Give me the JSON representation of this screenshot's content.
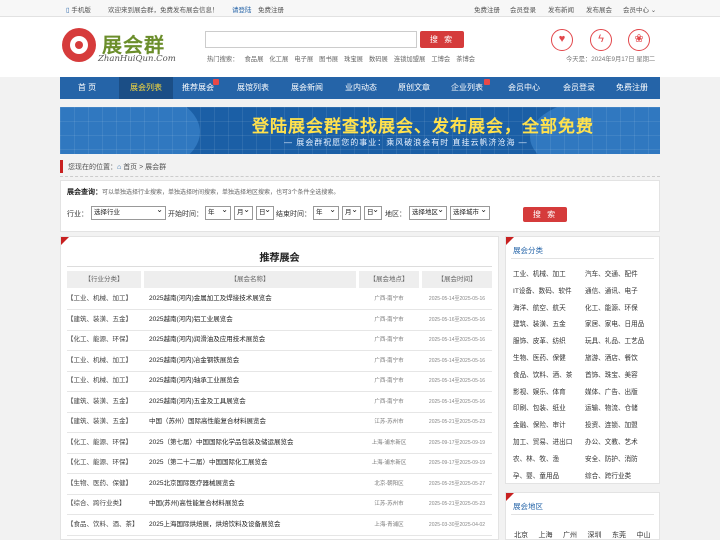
{
  "topbar": {
    "mobile": "手机版",
    "welcome": "欢迎来到展会群，免费发布展会信息！",
    "login": "请登陆",
    "register": "免费注册",
    "links": [
      "免费注册",
      "会员登录",
      "发布新闻",
      "发布展会",
      "会员中心 ⌄"
    ]
  },
  "logo": {
    "name": "展会群",
    "sub": "ZhanHuiQun.Com"
  },
  "search": {
    "placeholder": "",
    "button": "搜 索",
    "hot_label": "热门搜索：",
    "hot": [
      "食品展",
      "化工展",
      "电子展",
      "图书展",
      "珠宝展",
      "数码展",
      "连锁加盟展",
      "工博会",
      "茶博会"
    ]
  },
  "date": "今天是：2024年9月17日 星期二",
  "nav": [
    "首 页",
    "展会列表",
    "推荐展会",
    "展馆列表",
    "展会新闻",
    "业内动态",
    "原创文章",
    "企业列表",
    "会员中心",
    "会员登录",
    "免费注册"
  ],
  "banner": {
    "title": "登陆展会群查找展会、发布展会，全部免费",
    "slogan": "— 展会群祝愿您的事业：乘风破浪会有时 直挂云帆济沧海 —"
  },
  "breadcrumb": {
    "label": "您现在的位置：",
    "home": "首页",
    "sep": " > ",
    "current": "展会群"
  },
  "query": {
    "title": "展会查询：",
    "hint": "可以单独选择行业搜索，单独选择时间搜索，单独选择地区搜索，也可3个条件全选搜索。",
    "industry_label": "行业：",
    "industry": "选择行业",
    "start_label": "开始时间：",
    "end_label": "结束时间：",
    "year": "年",
    "month": "月",
    "day": "日",
    "region_label": "地区：",
    "region": "选择地区",
    "city": "选择城市",
    "button": "搜 索"
  },
  "recommend": {
    "title": "推荐展会",
    "headers": [
      "【行业分类】",
      "【展会名称】",
      "【展会地点】",
      "【展会时间】"
    ],
    "rows": [
      {
        "cat": "【工业、机械、加工】",
        "name": "2025越南(河内)金属加工及焊接技术展览会",
        "place": "广西-南宁市",
        "time": "2025-05-14至2025-05-16"
      },
      {
        "cat": "【建筑、装潢、五金】",
        "name": "2025越南(河内)铝工业展览会",
        "place": "广西-南宁市",
        "time": "2025-05-16至2025-05-16"
      },
      {
        "cat": "【化工、能源、环保】",
        "name": "2025越南(河内)润滑油及应用技术展览会",
        "place": "广西-南宁市",
        "time": "2025-05-14至2025-05-16"
      },
      {
        "cat": "【工业、机械、加工】",
        "name": "2025越南(河内)冶金钢铁展览会",
        "place": "广西-南宁市",
        "time": "2025-05-14至2025-05-16"
      },
      {
        "cat": "【工业、机械、加工】",
        "name": "2025越南(河内)轴承工业展览会",
        "place": "广西-南宁市",
        "time": "2025-05-14至2025-05-16"
      },
      {
        "cat": "【建筑、装潢、五金】",
        "name": "2025越南(河内)五金及工具展览会",
        "place": "广西-南宁市",
        "time": "2025-05-14至2025-05-16"
      },
      {
        "cat": "【建筑、装潢、五金】",
        "name": "中国（苏州）国际高性能复合材料展览会",
        "place": "江苏-苏州市",
        "time": "2025-05-21至2025-05-23"
      },
      {
        "cat": "【化工、能源、环保】",
        "name": "2025（第七届）中国国际化学品包装及储运展览会",
        "place": "上海-浦东新区",
        "time": "2025-09-17至2025-09-19"
      },
      {
        "cat": "【化工、能源、环保】",
        "name": "2025（第二十二届）中国国际化工展览会",
        "place": "上海-浦东新区",
        "time": "2025-09-17至2025-09-19"
      },
      {
        "cat": "【生物、医药、保健】",
        "name": "2025北京国际医疗器械展览会",
        "place": "北京-朝阳区",
        "time": "2025-05-25至2025-05-27"
      },
      {
        "cat": "【综合、跨行业类】",
        "name": "中国(苏州)高性能复合材料展览会",
        "place": "江苏-苏州市",
        "time": "2025-05-21至2025-05-23"
      },
      {
        "cat": "【食品、饮料、酒、茶】",
        "name": "2025上海国际烘焙展，烘焙饮料及设备展览会",
        "place": "上海-青浦区",
        "time": "2025-03-30至2025-04-02"
      }
    ]
  },
  "categories": {
    "title": "展会分类",
    "items": [
      [
        "工业、机械、加工",
        "汽车、交通、配件"
      ],
      [
        "IT设备、数码、软件",
        "通信、通讯、电子"
      ],
      [
        "海洋、航空、航天",
        "化工、能源、环保"
      ],
      [
        "建筑、装潢、五金",
        "家居、家电、日用品"
      ],
      [
        "服饰、皮革、纺织",
        "玩具、礼品、工艺品"
      ],
      [
        "生物、医药、保健",
        "旅游、酒店、餐饮"
      ],
      [
        "食品、饮料、酒、茶",
        "首饰、珠宝、美容"
      ],
      [
        "影视、娱乐、体育",
        "媒体、广告、出版"
      ],
      [
        "印刷、包装、纸业",
        "运输、物流、仓储"
      ],
      [
        "金融、保险、审计",
        "投资、连锁、加盟"
      ],
      [
        "加工、贸易、进出口",
        "办公、文教、艺术"
      ],
      [
        "农、林、牧、渔",
        "安全、防护、消防"
      ],
      [
        "孕、婴、童用品",
        "综合、跨行业类"
      ]
    ]
  },
  "regions": {
    "title": "展会地区",
    "cities": [
      "北京",
      "上海",
      "广州",
      "深圳",
      "东莞",
      "中山"
    ]
  }
}
